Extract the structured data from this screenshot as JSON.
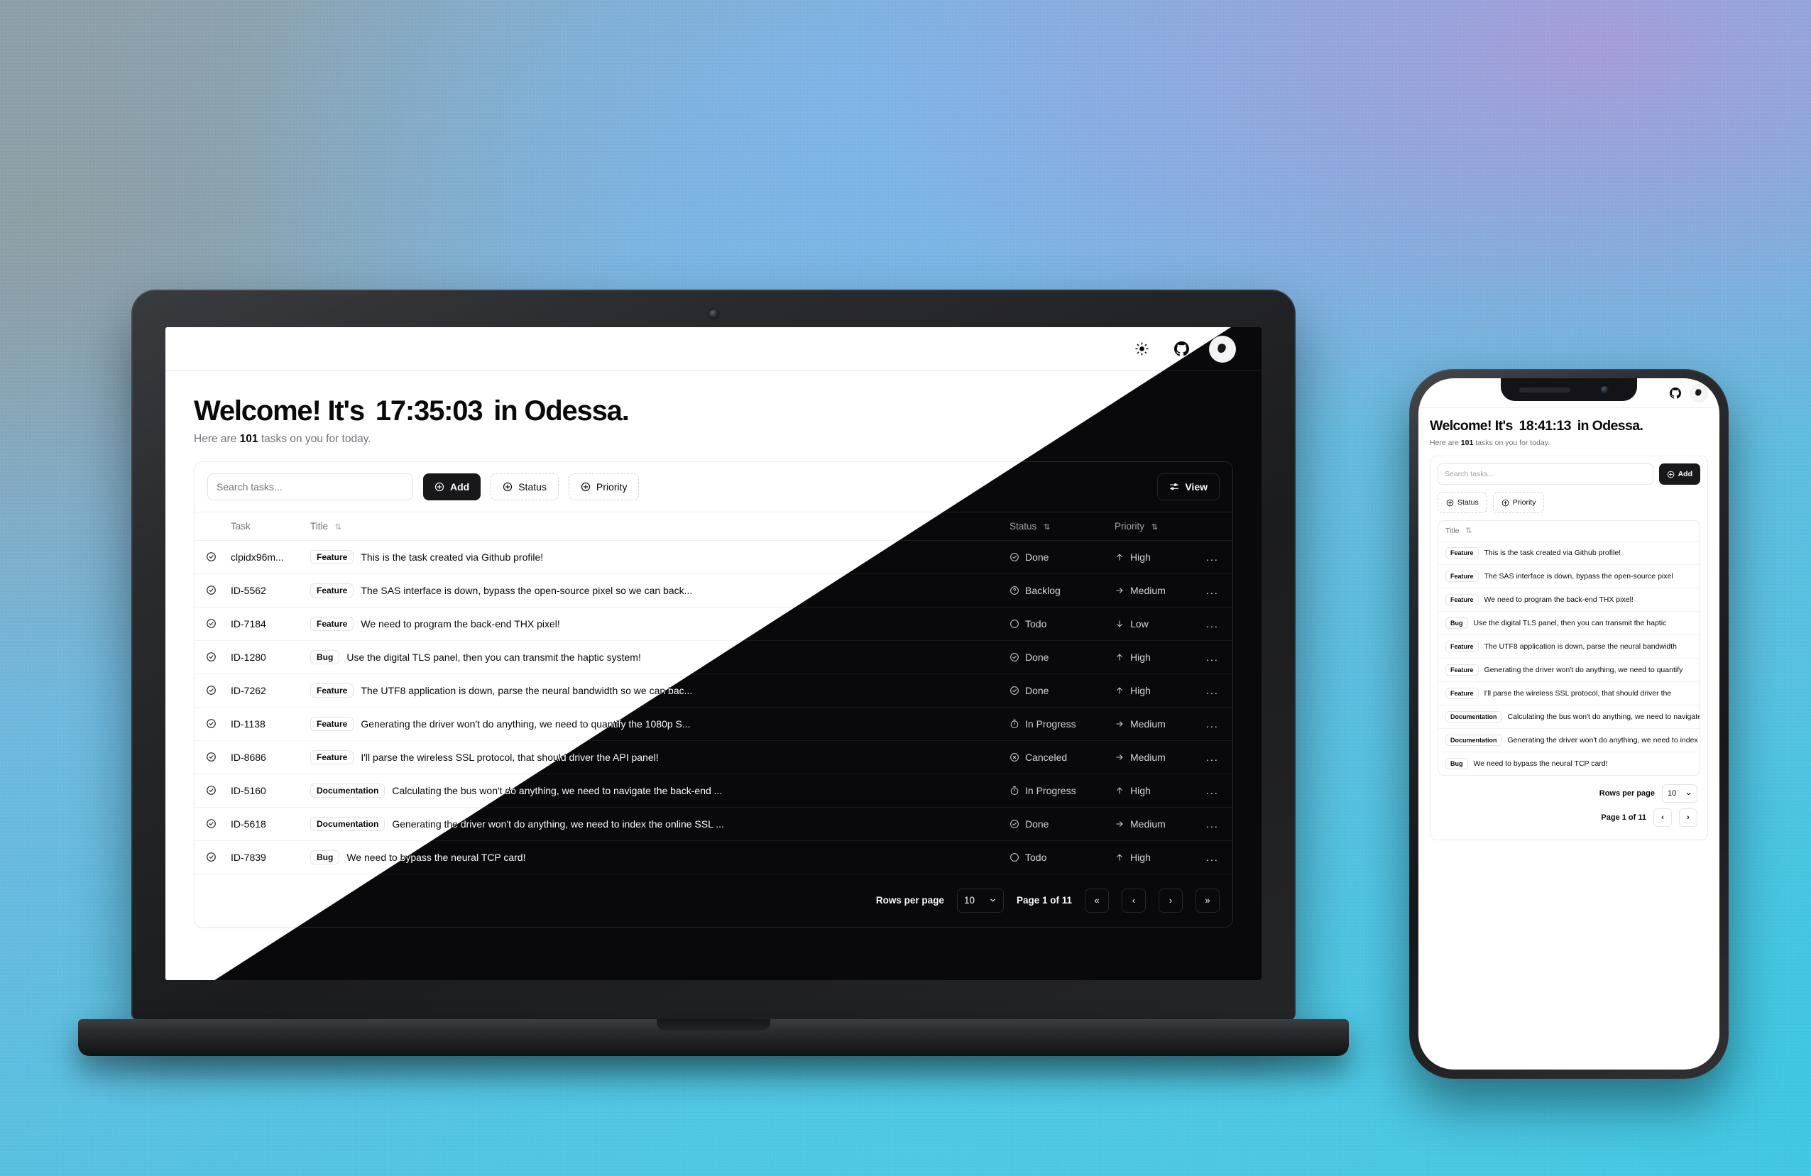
{
  "background": {
    "colors": {
      "purple": "#a59ddb",
      "blue": "#7fb4e8",
      "cyan": "#4fc9e4",
      "gray": "#8fa3ae"
    }
  },
  "theme": {
    "light_bg": "#ffffff",
    "dark_bg": "#09090b",
    "accent": "#18181b",
    "muted_text": "#71717a"
  },
  "laptop": {
    "topbar": {
      "theme_toggle_label": "sun-icon",
      "github_label": "github-icon",
      "avatar_label": "user-avatar"
    },
    "header": {
      "greeting_prefix": "Welcome! It's",
      "clock": "17:35:03",
      "location_suffix": "in Odessa.",
      "sub_prefix": "Here are",
      "task_count": "101",
      "sub_suffix": "tasks on you for today."
    },
    "toolbar": {
      "search_placeholder": "Search tasks...",
      "search_value": "",
      "add_label": "Add",
      "status_label": "Status",
      "priority_label": "Priority",
      "view_label": "View"
    },
    "table": {
      "columns": {
        "task": "Task",
        "title": "Title",
        "status": "Status",
        "priority": "Priority"
      },
      "rows": [
        {
          "id": "clpidx96m...",
          "type": "Feature",
          "title": "This is the task created via Github profile!",
          "status": "Done",
          "priority": "High",
          "status_icon": "check-circle-icon",
          "priority_icon": "arrow-up-icon"
        },
        {
          "id": "ID-5562",
          "type": "Feature",
          "title": "The SAS interface is down, bypass the open-source pixel so we can back...",
          "status": "Backlog",
          "priority": "Medium",
          "status_icon": "question-circle-icon",
          "priority_icon": "arrow-right-icon"
        },
        {
          "id": "ID-7184",
          "type": "Feature",
          "title": "We need to program the back-end THX pixel!",
          "status": "Todo",
          "priority": "Low",
          "status_icon": "circle-icon",
          "priority_icon": "arrow-down-icon"
        },
        {
          "id": "ID-1280",
          "type": "Bug",
          "title": "Use the digital TLS panel, then you can transmit the haptic system!",
          "status": "Done",
          "priority": "High",
          "status_icon": "check-circle-icon",
          "priority_icon": "arrow-up-icon"
        },
        {
          "id": "ID-7262",
          "type": "Feature",
          "title": "The UTF8 application is down, parse the neural bandwidth so we can bac...",
          "status": "Done",
          "priority": "High",
          "status_icon": "check-circle-icon",
          "priority_icon": "arrow-up-icon"
        },
        {
          "id": "ID-1138",
          "type": "Feature",
          "title": "Generating the driver won't do anything, we need to quantify the 1080p S...",
          "status": "In Progress",
          "priority": "Medium",
          "status_icon": "timer-icon",
          "priority_icon": "arrow-right-icon"
        },
        {
          "id": "ID-8686",
          "type": "Feature",
          "title": "I'll parse the wireless SSL protocol, that should driver the API panel!",
          "status": "Canceled",
          "priority": "Medium",
          "status_icon": "x-circle-icon",
          "priority_icon": "arrow-right-icon"
        },
        {
          "id": "ID-5160",
          "type": "Documentation",
          "title": "Calculating the bus won't do anything, we need to navigate the back-end ...",
          "status": "In Progress",
          "priority": "High",
          "status_icon": "timer-icon",
          "priority_icon": "arrow-up-icon"
        },
        {
          "id": "ID-5618",
          "type": "Documentation",
          "title": "Generating the driver won't do anything, we need to index the online SSL ...",
          "status": "Done",
          "priority": "Medium",
          "status_icon": "check-circle-icon",
          "priority_icon": "arrow-right-icon"
        },
        {
          "id": "ID-7839",
          "type": "Bug",
          "title": "We need to bypass the neural TCP card!",
          "status": "Todo",
          "priority": "High",
          "status_icon": "circle-icon",
          "priority_icon": "arrow-up-icon"
        }
      ],
      "row_more_label": "..."
    },
    "pagination": {
      "rows_per_page_label": "Rows per page",
      "rows_per_page_value": "10",
      "page_label": "Page 1 of 11",
      "first_label": "«",
      "prev_label": "‹",
      "next_label": "›",
      "last_label": "»"
    }
  },
  "phone": {
    "topbar": {
      "github_label": "github-icon",
      "avatar_label": "user-avatar"
    },
    "header": {
      "greeting_prefix": "Welcome! It's",
      "clock": "18:41:13",
      "location_suffix": "in Odessa.",
      "sub_prefix": "Here are",
      "task_count": "101",
      "sub_suffix": "tasks on you for today."
    },
    "toolbar": {
      "search_placeholder": "Search tasks...",
      "add_label": "Add",
      "status_label": "Status",
      "priority_label": "Priority"
    },
    "list": {
      "column_title": "Title",
      "rows": [
        {
          "type": "Feature",
          "title": "This is the task created via Github profile!"
        },
        {
          "type": "Feature",
          "title": "The SAS interface is down, bypass the open-source pixel"
        },
        {
          "type": "Feature",
          "title": "We need to program the back-end THX pixel!"
        },
        {
          "type": "Bug",
          "title": "Use the digital TLS panel, then you can transmit the haptic"
        },
        {
          "type": "Feature",
          "title": "The UTF8 application is down, parse the neural bandwidth"
        },
        {
          "type": "Feature",
          "title": "Generating the driver won't do anything, we need to quantify"
        },
        {
          "type": "Feature",
          "title": "I'll parse the wireless SSL protocol, that should driver the"
        },
        {
          "type": "Documentation",
          "title": "Calculating the bus won't do anything, we need to navigate"
        },
        {
          "type": "Documentation",
          "title": "Generating the driver won't do anything, we need to index"
        },
        {
          "type": "Bug",
          "title": "We need to bypass the neural TCP card!"
        }
      ]
    },
    "pagination": {
      "rows_per_page_label": "Rows per page",
      "rows_per_page_value": "10",
      "page_label": "Page 1 of 11",
      "prev_label": "‹",
      "next_label": "›"
    }
  }
}
